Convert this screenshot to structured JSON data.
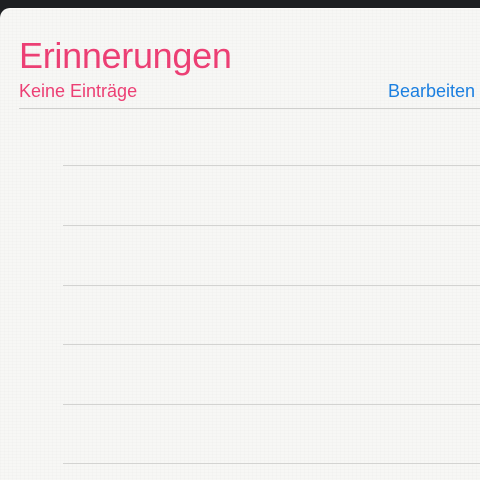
{
  "status_bar": {
    "carrier": "",
    "time": "",
    "battery": ""
  },
  "header": {
    "title": "Erinnerungen",
    "subtitle": "Keine Einträge",
    "edit_label": "Bearbeiten"
  },
  "colors": {
    "accent": "#ec3f74",
    "link": "#1b7fe0",
    "paper": "#f7f7f5",
    "rule": "#d3d3d1"
  }
}
